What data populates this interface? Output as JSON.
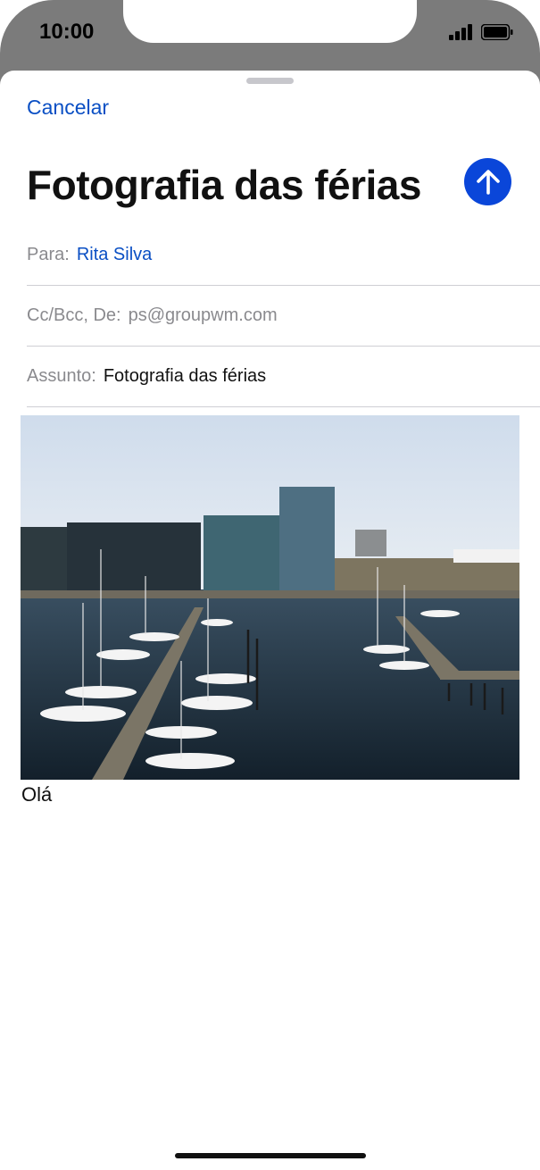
{
  "status": {
    "time": "10:00"
  },
  "compose": {
    "cancel_label": "Cancelar",
    "title": "Fotografia das férias",
    "to_label": "Para:",
    "to_value": "Rita Silva",
    "cc_label": "Cc/Bcc, De:",
    "cc_value": "ps@groupwm.com",
    "subject_label": "Assunto:",
    "subject_value": "Fotografia das férias",
    "body_text": "Olá"
  },
  "colors": {
    "accent": "#0a4fc4",
    "send_button": "#0a46d9",
    "chrome": "#7b7b7b"
  },
  "icons": {
    "send": "arrow-up-icon",
    "signal": "signal-bars-icon",
    "battery": "battery-icon"
  }
}
